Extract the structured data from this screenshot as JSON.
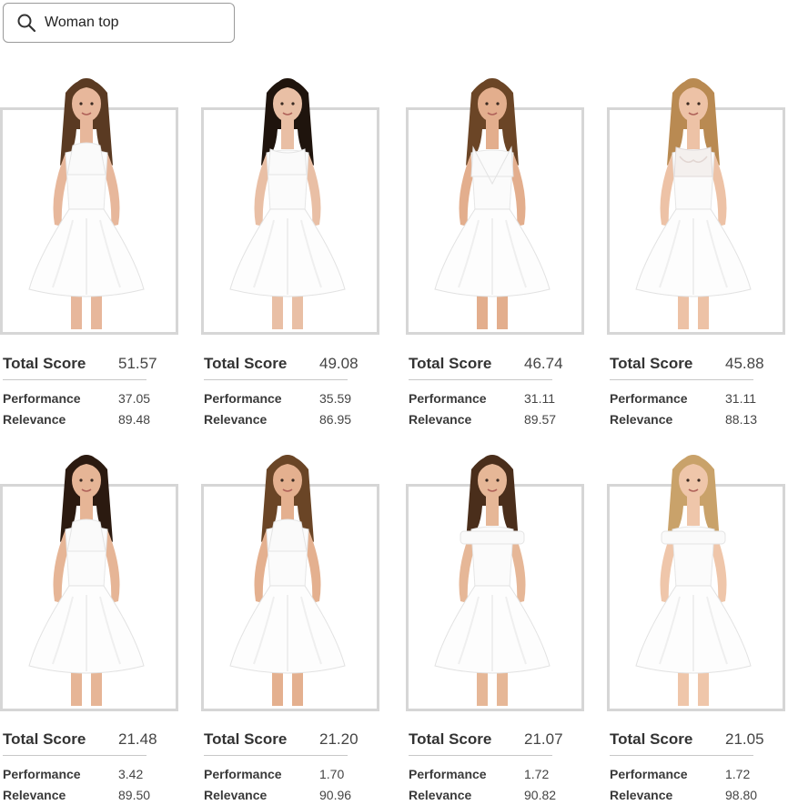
{
  "search": {
    "value": "Woman top",
    "placeholder": ""
  },
  "labels": {
    "total": "Total Score",
    "performance": "Performance",
    "relevance": "Relevance"
  },
  "products": [
    {
      "total": "51.57",
      "performance": "37.05",
      "relevance": "89.48",
      "hair": "#5a3a22",
      "skin": "#e7b79b",
      "neck": "halter"
    },
    {
      "total": "49.08",
      "performance": "35.59",
      "relevance": "86.95",
      "hair": "#1f140d",
      "skin": "#e9bfa5",
      "neck": "tank"
    },
    {
      "total": "46.74",
      "performance": "31.11",
      "relevance": "89.57",
      "hair": "#6b4526",
      "skin": "#e3ae8d",
      "neck": "vneck"
    },
    {
      "total": "45.88",
      "performance": "31.11",
      "relevance": "88.13",
      "hair": "#b98a52",
      "skin": "#edc2a6",
      "neck": "lace"
    },
    {
      "total": "21.48",
      "performance": "3.42",
      "relevance": "89.50",
      "hair": "#2b1a10",
      "skin": "#e6b596",
      "neck": "halter"
    },
    {
      "total": "21.20",
      "performance": "1.70",
      "relevance": "90.96",
      "hair": "#6a4526",
      "skin": "#e4b08f",
      "neck": "halter"
    },
    {
      "total": "21.07",
      "performance": "1.72",
      "relevance": "90.82",
      "hair": "#4a2e1b",
      "skin": "#e6b797",
      "neck": "offshoulder"
    },
    {
      "total": "21.05",
      "performance": "1.72",
      "relevance": "98.80",
      "hair": "#c9a26a",
      "skin": "#efc6aa",
      "neck": "offshoulder"
    }
  ]
}
